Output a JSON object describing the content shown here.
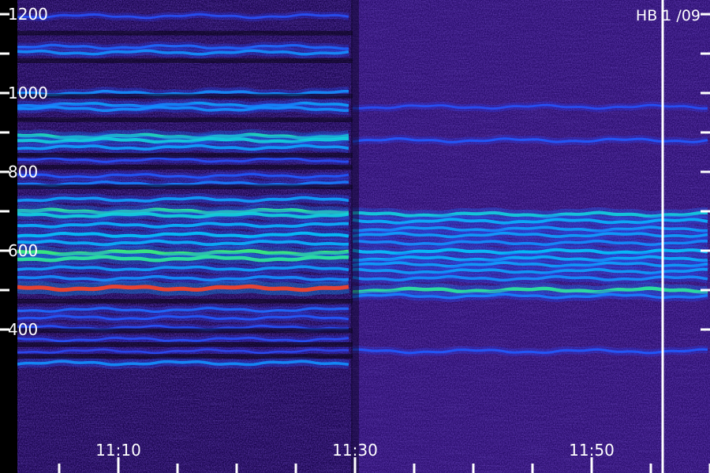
{
  "chart_data": {
    "type": "heatmap",
    "title": "",
    "label": "HB 1 /09",
    "xlabel": "",
    "ylabel": "",
    "x_ticks": [
      "11:10",
      "11:30",
      "11:50"
    ],
    "x_range_minutes": [
      11.0,
      12.0
    ],
    "y_ticks": [
      400,
      600,
      800,
      1000,
      1200
    ],
    "y_range": [
      320,
      1200
    ],
    "minor_y_ticks": [
      500,
      700,
      900,
      1100
    ],
    "event_line_time": "11:55",
    "colors": {
      "background": "#000000",
      "noise": "#2a0a6e",
      "low": "#3c14c8",
      "mid": "#1e5aff",
      "high": "#00c8ff",
      "peak": "#3cff6e",
      "max": "#ff4020",
      "text": "#ffffff"
    },
    "bands_before": [
      {
        "freq": 1195,
        "intensity": 0.35
      },
      {
        "freq": 1117,
        "intensity": 0.45
      },
      {
        "freq": 1103,
        "intensity": 0.55
      },
      {
        "freq": 1000,
        "intensity": 0.55
      },
      {
        "freq": 970,
        "intensity": 0.6
      },
      {
        "freq": 960,
        "intensity": 0.55
      },
      {
        "freq": 890,
        "intensity": 0.8
      },
      {
        "freq": 880,
        "intensity": 0.75
      },
      {
        "freq": 862,
        "intensity": 0.6
      },
      {
        "freq": 830,
        "intensity": 0.35
      },
      {
        "freq": 790,
        "intensity": 0.4
      },
      {
        "freq": 770,
        "intensity": 0.5
      },
      {
        "freq": 730,
        "intensity": 0.6
      },
      {
        "freq": 700,
        "intensity": 0.85
      },
      {
        "freq": 690,
        "intensity": 0.75
      },
      {
        "freq": 665,
        "intensity": 0.65
      },
      {
        "freq": 640,
        "intensity": 0.7
      },
      {
        "freq": 620,
        "intensity": 0.65
      },
      {
        "freq": 595,
        "intensity": 0.9
      },
      {
        "freq": 580,
        "intensity": 0.85
      },
      {
        "freq": 555,
        "intensity": 0.6
      },
      {
        "freq": 530,
        "intensity": 0.55
      },
      {
        "freq": 505,
        "intensity": 1.0
      },
      {
        "freq": 450,
        "intensity": 0.45
      },
      {
        "freq": 430,
        "intensity": 0.4
      },
      {
        "freq": 405,
        "intensity": 0.35
      },
      {
        "freq": 375,
        "intensity": 0.35
      },
      {
        "freq": 345,
        "intensity": 0.3
      },
      {
        "freq": 315,
        "intensity": 0.55
      }
    ],
    "bands_after": [
      {
        "freq": 965,
        "intensity": 0.35
      },
      {
        "freq": 880,
        "intensity": 0.4
      },
      {
        "freq": 692,
        "intensity": 0.75
      },
      {
        "freq": 675,
        "intensity": 0.65
      },
      {
        "freq": 655,
        "intensity": 0.6
      },
      {
        "freq": 640,
        "intensity": 0.6
      },
      {
        "freq": 620,
        "intensity": 0.55
      },
      {
        "freq": 598,
        "intensity": 0.7
      },
      {
        "freq": 580,
        "intensity": 0.65
      },
      {
        "freq": 565,
        "intensity": 0.6
      },
      {
        "freq": 548,
        "intensity": 0.6
      },
      {
        "freq": 530,
        "intensity": 0.55
      },
      {
        "freq": 500,
        "intensity": 0.85
      },
      {
        "freq": 485,
        "intensity": 0.5
      },
      {
        "freq": 345,
        "intensity": 0.4
      }
    ]
  }
}
